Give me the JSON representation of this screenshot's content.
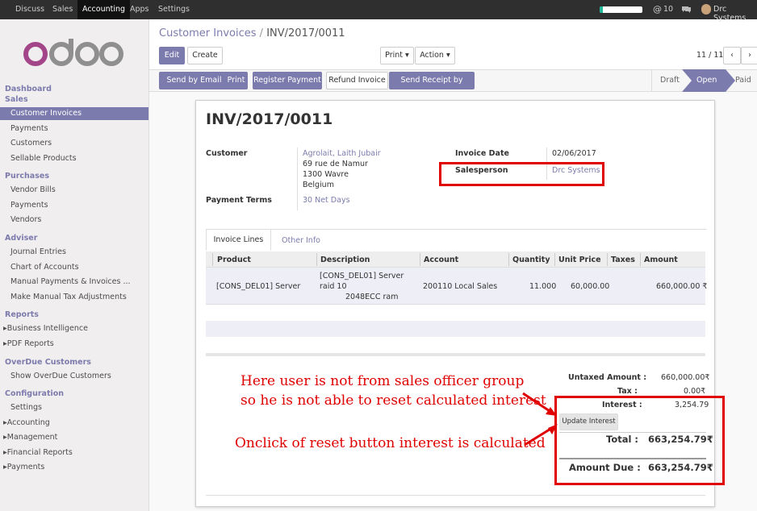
{
  "topbar": {
    "menus": [
      "Discuss",
      "Sales",
      "Accounting",
      "Apps",
      "Settings"
    ],
    "active": "Accounting",
    "messages_count": "10",
    "user": "Drc Systems",
    "progress": 0.08
  },
  "sidebar": {
    "sections": [
      {
        "title": "Dashboard",
        "items": []
      },
      {
        "title": "Sales",
        "items": [
          "Customer Invoices",
          "Payments",
          "Customers",
          "Sellable Products"
        ]
      },
      {
        "title": "Purchases",
        "items": [
          "Vendor Bills",
          "Payments",
          "Vendors"
        ]
      },
      {
        "title": "Adviser",
        "items": [
          "Journal Entries",
          "Chart of Accounts",
          "Manual Payments & Invoices ...",
          "Make Manual Tax Adjustments"
        ]
      },
      {
        "title": "Reports",
        "items": [
          "Business Intelligence",
          "PDF Reports"
        ]
      },
      {
        "title": "OverDue Customers",
        "items": [
          "Show OverDue Customers"
        ]
      },
      {
        "title": "Configuration",
        "items": [
          "Settings",
          "Accounting",
          "Management",
          "Financial Reports",
          "Payments"
        ]
      }
    ]
  },
  "breadcrumb": {
    "parent": "Customer Invoices",
    "separator": "/",
    "current": "INV/2017/0011"
  },
  "toolbar": {
    "edit": "Edit",
    "create": "Create",
    "print": "Print",
    "action": "Action",
    "pager": "11 / 11"
  },
  "actions": {
    "send_email": "Send by Email",
    "print": "Print",
    "register_payment": "Register Payment",
    "refund": "Refund Invoice",
    "send_receipt": "Send Receipt by email"
  },
  "status": {
    "draft": "Draft",
    "open": "Open",
    "paid": "Paid"
  },
  "invoice": {
    "number": "INV/2017/0011",
    "customer_label": "Customer",
    "customer_name": "Agrolait, Laith Jubair",
    "addr1": "69 rue de Namur",
    "addr2": "1300 Wavre",
    "addr3": "Belgium",
    "terms_label": "Payment Terms",
    "terms": "30 Net Days",
    "date_label": "Invoice Date",
    "date": "02/06/2017",
    "salesperson_label": "Salesperson",
    "salesperson": "Drc Systems"
  },
  "tabs": {
    "lines": "Invoice Lines",
    "other": "Other Info"
  },
  "lines": {
    "headers": [
      "Product",
      "Description",
      "Account",
      "Quantity",
      "Unit Price",
      "Taxes",
      "Amount"
    ],
    "row": {
      "product": "[CONS_DEL01] Server",
      "desc1": "[CONS_DEL01] Server",
      "desc2": "raid 10",
      "desc3": "2048ECC ram",
      "account": "200110 Local Sales",
      "qty": "11.000",
      "price": "60,000.00",
      "taxes": "",
      "amount": "660,000.00 ₹"
    }
  },
  "totals": {
    "untaxed_label": "Untaxed Amount :",
    "untaxed": "660,000.00₹",
    "tax_label": "Tax :",
    "tax": "0.00₹",
    "interest_label": "Interest :",
    "interest": "3,254.79",
    "update_btn": "Update Interest",
    "total_label": "Total :",
    "total": "663,254.79₹",
    "due_label": "Amount Due :",
    "due": "663,254.79₹"
  },
  "annotations": {
    "note1a": "Here user is not from sales officer group",
    "note1b": "so he is not able to reset calculated interest",
    "note2": "Onclick of reset button interest is calculated"
  }
}
